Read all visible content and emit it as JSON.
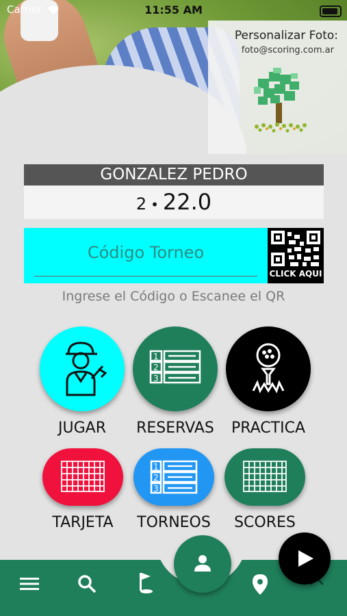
{
  "status_bar": {
    "carrier": "Carrier",
    "time": "11:55 AM"
  },
  "photo_panel": {
    "title": "Personalizar Foto:",
    "email": "foto@scoring.com.ar"
  },
  "player": {
    "name": "GONZALEZ PEDRO",
    "number": "2",
    "separator": "•",
    "handicap": "22.0"
  },
  "tournament_code": {
    "placeholder": "Código Torneo",
    "qr_label": "CLICK AQUI",
    "hint": "Ingrese el Código o Escanee el QR"
  },
  "menu": {
    "jugar": "JUGAR",
    "reservas": "RESERVAS",
    "practica": "PRACTICA",
    "tarjeta": "TARJETA",
    "torneos": "TORNEOS",
    "scores": "SCORES"
  },
  "colors": {
    "cyan": "#00ffff",
    "green": "#1f7f5b",
    "black": "#000000",
    "red": "#f0113c",
    "blue": "#2196f3"
  },
  "icons": {
    "bottom_nav": [
      "menu-icon",
      "search-icon",
      "golf-hole-icon",
      "person-icon",
      "location-icon",
      "chevron-up-icon"
    ],
    "fab": "play-icon"
  }
}
